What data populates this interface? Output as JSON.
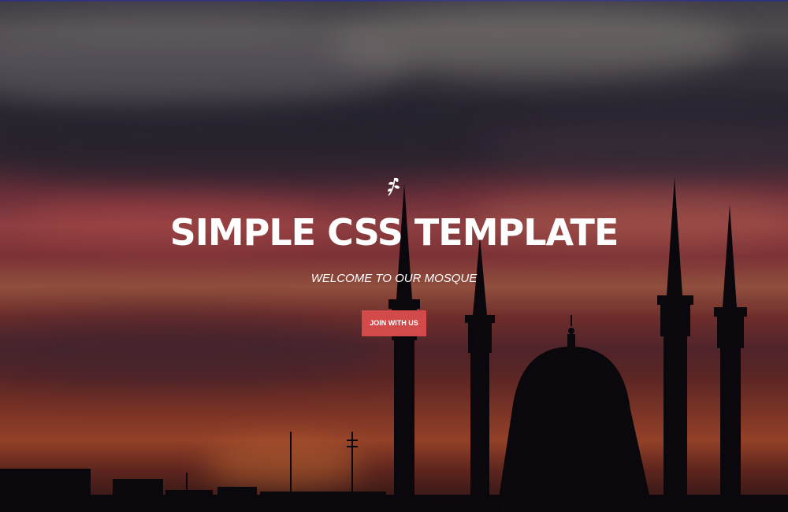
{
  "hero": {
    "icon": "leaf-icon",
    "title": "SIMPLE CSS TEMPLATE",
    "subtitle": "WELCOME TO OUR MOSQUE",
    "button_label": "JOIN WITH US",
    "colors": {
      "button": "#d24a4a",
      "text": "#ffffff"
    }
  },
  "background": {
    "scene": "mosque-silhouette-sunset"
  }
}
